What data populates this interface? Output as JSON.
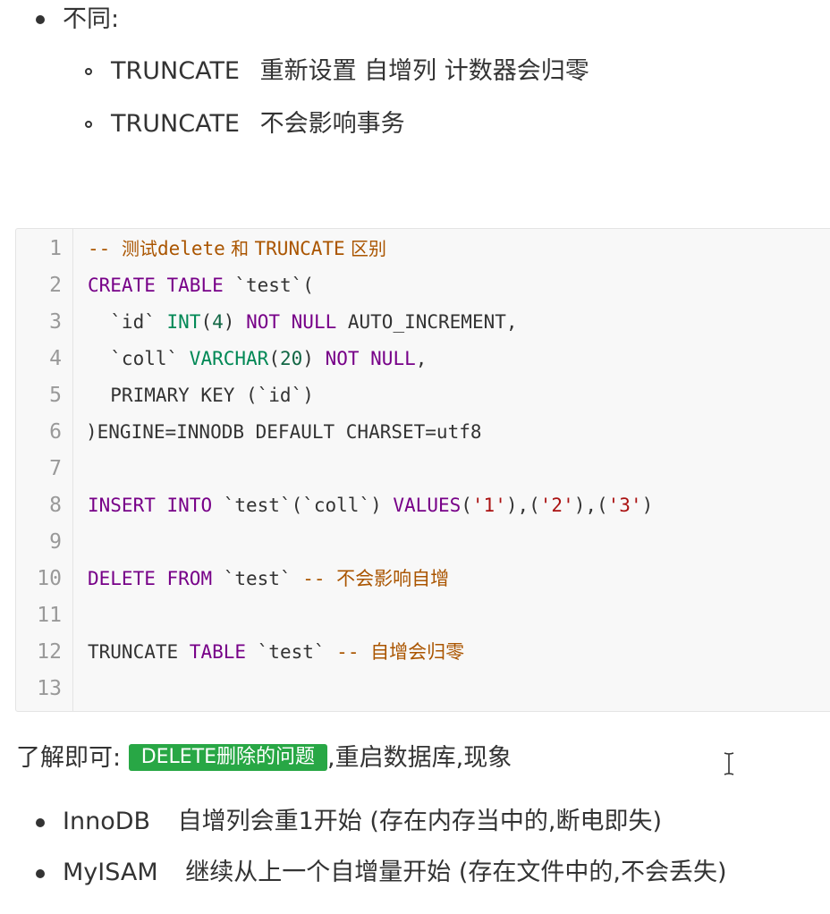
{
  "bullets_top": {
    "heading": "不同:",
    "items": [
      {
        "keyword": "TRUNCATE",
        "text": "重新设置 自增列 计数器会归零"
      },
      {
        "keyword": "TRUNCATE",
        "text": "不会影响事务"
      }
    ]
  },
  "code": {
    "line_numbers": [
      "1",
      "2",
      "3",
      "4",
      "5",
      "6",
      "7",
      "8",
      "9",
      "10",
      "11",
      "12",
      "13"
    ],
    "l1": {
      "dash": "-- ",
      "c1": "测试",
      "c2": "delete",
      "c3": " 和 ",
      "c4": "TRUNCATE",
      "c5": " 区别"
    },
    "l2": {
      "k1": "CREATE",
      "k2": "TABLE",
      "t1": " `test`("
    },
    "l3": {
      "t1": "  `id` ",
      "ty": "INT",
      "t2": "(",
      "n": "4",
      "t3": ") ",
      "k1": "NOT",
      "k2": "NULL",
      "t4": " AUTO_INCREMENT,"
    },
    "l4": {
      "t1": "  `coll` ",
      "ty": "VARCHAR",
      "t2": "(",
      "n": "20",
      "t3": ") ",
      "k1": "NOT",
      "k2": "NULL",
      "t4": ","
    },
    "l5": {
      "t1": "  PRIMARY KEY (`id`)"
    },
    "l6": {
      "t1": ")ENGINE=INNODB DEFAULT CHARSET=utf8"
    },
    "l8": {
      "k1": "INSERT",
      "k2": "INTO",
      "t1": " `test`(`coll`) ",
      "k3": "VALUES",
      "t2": "(",
      "s1": "'1'",
      "t3": "),(",
      "s2": "'2'",
      "t4": "),(",
      "s3": "'3'",
      "t5": ")"
    },
    "l10": {
      "k1": "DELETE",
      "k2": "FROM",
      "t1": " `test` ",
      "cm": "-- 不会影响自增"
    },
    "l12": {
      "t1": "TRUNCATE ",
      "k1": "TABLE",
      "t2": " `test` ",
      "cm": "-- 自增会归零"
    }
  },
  "note": {
    "prefix": "了解即可:",
    "tag": "DELETE删除的问题",
    "suffix": ",重启数据库,现象"
  },
  "bullets_bottom": [
    {
      "name": "InnoDB",
      "text": "自增列会重1开始 (存在内存当中的,断电即失)"
    },
    {
      "name": "MyISAM",
      "text": "继续从上一个自增量开始 (存在文件中的,不会丢失)"
    }
  ],
  "colors": {
    "comment": "#aa5500",
    "keyword": "#770088",
    "type": "#008855",
    "number": "#116644",
    "string": "#aa1111",
    "tag_bg": "#28a745"
  },
  "icons": {
    "cursor": "text-cursor-icon"
  }
}
